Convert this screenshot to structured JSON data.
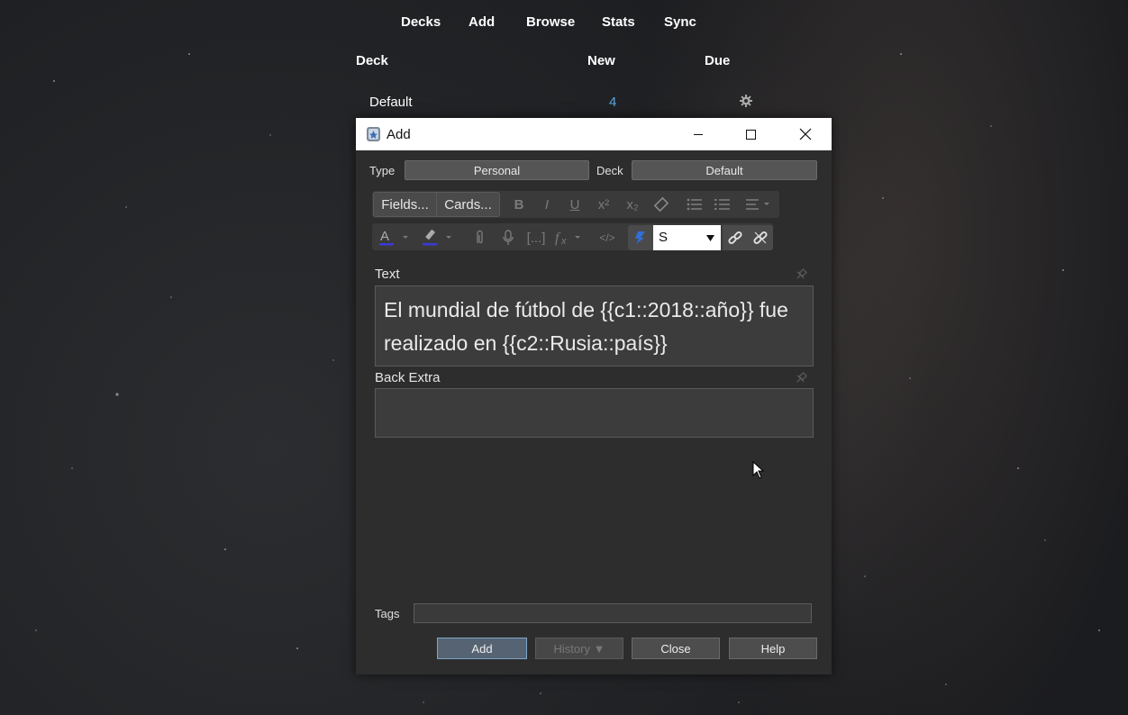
{
  "topnav": {
    "items": [
      "Decks",
      "Add",
      "Browse",
      "Stats",
      "Sync"
    ]
  },
  "deck_table": {
    "headers": {
      "deck": "Deck",
      "new": "New",
      "due": "Due"
    },
    "rows": [
      {
        "name": "Default",
        "new": "4",
        "due": ""
      }
    ]
  },
  "dialog": {
    "title": "Add",
    "type_label": "Type",
    "type_value": "Personal",
    "deck_label": "Deck",
    "deck_value": "Default",
    "toolbar": {
      "fields_btn": "Fields...",
      "cards_btn": "Cards...",
      "cloze_field_value": "S"
    },
    "fields": [
      {
        "name": "Text",
        "value": "El mundial de fútbol de {{c1::2018::año}} fue realizado en {{c2::Rusia::país}}"
      },
      {
        "name": "Back Extra",
        "value": ""
      }
    ],
    "tags_label": "Tags",
    "tags_value": "",
    "buttons": {
      "add": "Add",
      "history": "History ▼",
      "close": "Close",
      "help": "Help"
    }
  },
  "colors": {
    "new_count": "#5aa7e0",
    "field_bg": "#3c3c3c",
    "dialog_bg": "#2d2d2d",
    "primary_border": "#7fa6c9"
  },
  "icons": [
    "gear-icon",
    "anki-app-icon",
    "minimize-icon",
    "maximize-icon",
    "close-icon",
    "bold-icon",
    "italic-icon",
    "underline-icon",
    "superscript-icon",
    "subscript-icon",
    "eraser-icon",
    "bullet-list-icon",
    "numbered-list-icon",
    "align-icon",
    "text-color-icon",
    "highlight-icon",
    "attach-icon",
    "microphone-icon",
    "cloze-icon",
    "formula-icon",
    "html-icon",
    "sticky-pin-icon",
    "link-icon",
    "unlink-icon",
    "pin-icon",
    "mouse-cursor-icon"
  ]
}
